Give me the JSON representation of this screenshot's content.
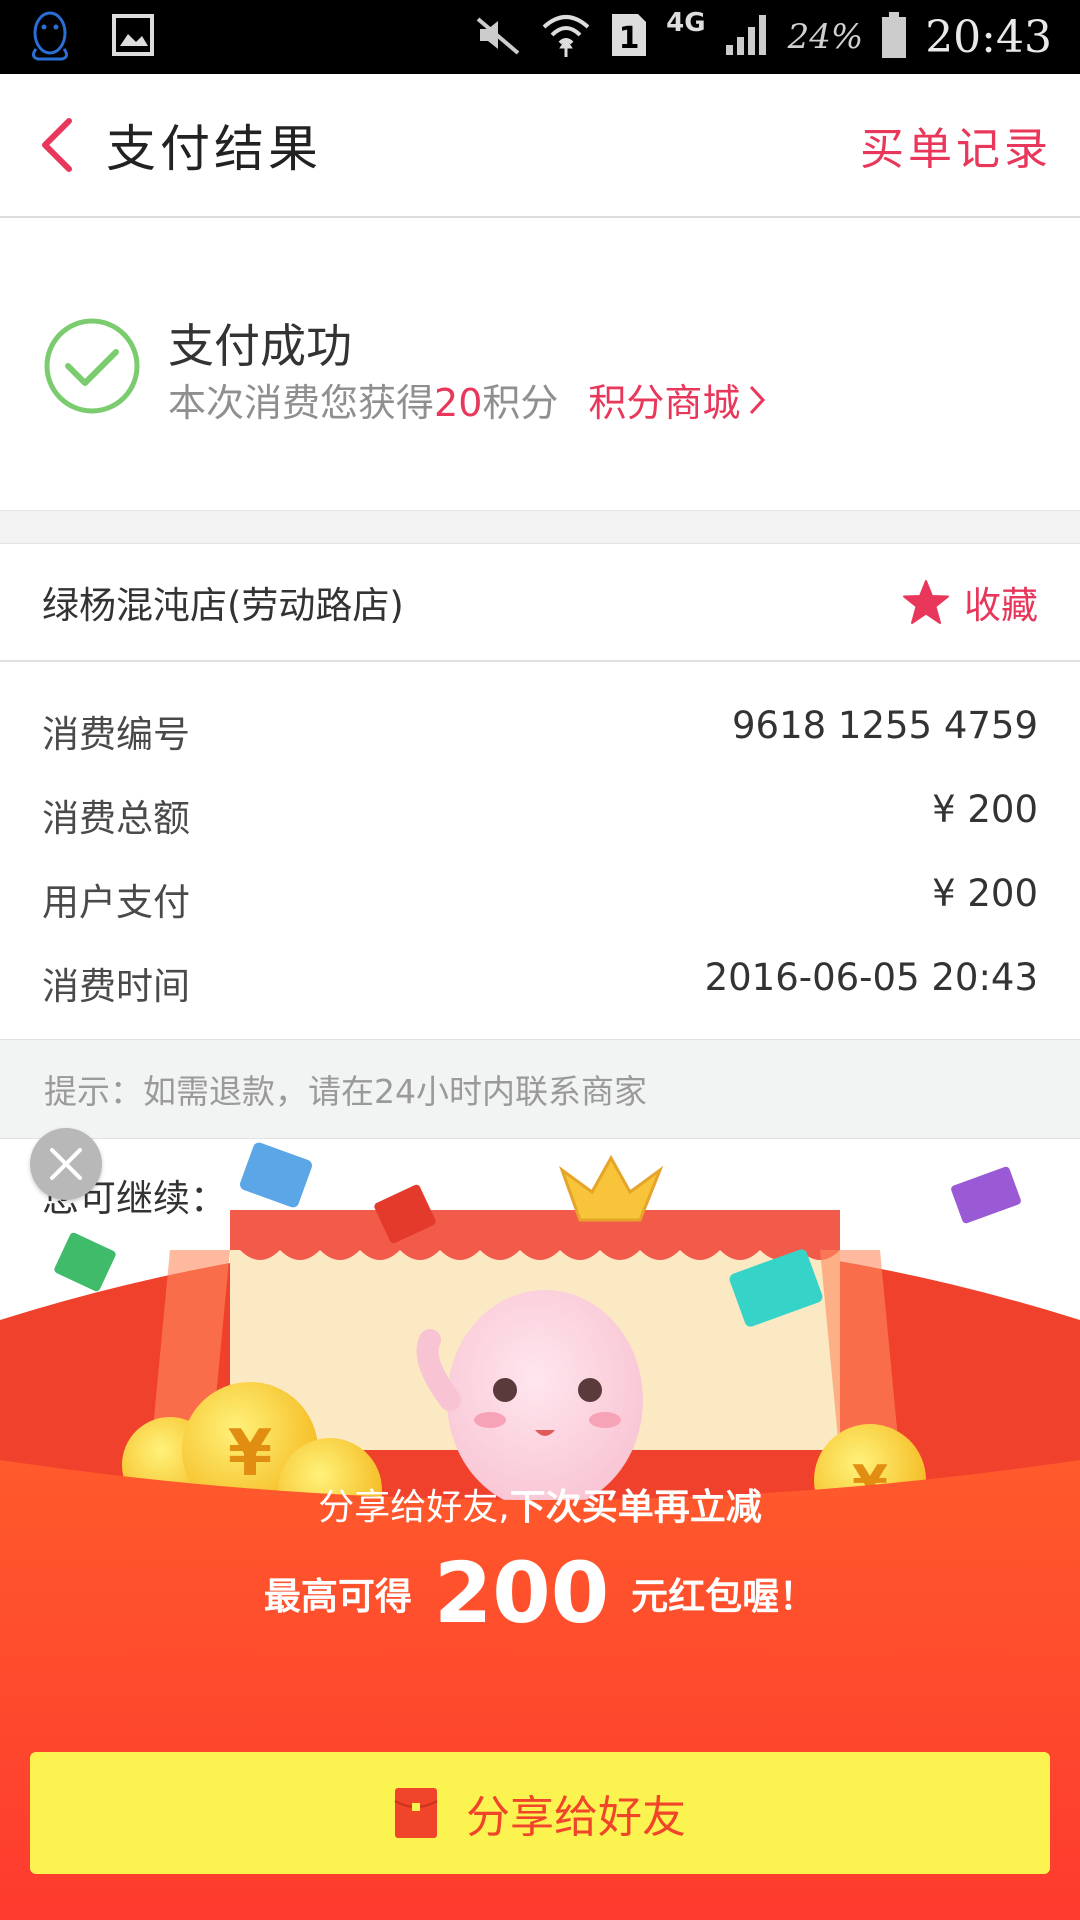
{
  "status_bar": {
    "battery": "24%",
    "network": "4G",
    "sim": "1",
    "time": "20:43"
  },
  "header": {
    "title": "支付结果",
    "records_link": "买单记录"
  },
  "success": {
    "title": "支付成功",
    "subtitle_prefix": "本次消费您获得",
    "points": "20",
    "subtitle_suffix": "积分",
    "mall_link": "积分商城"
  },
  "store": {
    "name": "绿杨混沌店(劳动路店)",
    "favorite_label": "收藏"
  },
  "details": [
    {
      "label": "消费编号",
      "value": "9618 1255 4759"
    },
    {
      "label": "消费总额",
      "value": "¥ 200"
    },
    {
      "label": "用户支付",
      "value": "¥ 200"
    },
    {
      "label": "消费时间",
      "value": "2016-06-05 20:43"
    }
  ],
  "tip": "提示：如需退款，请在24小时内联系商家",
  "continue_label": "您可继续：",
  "promo": {
    "line1_normal": "分享给好友,",
    "line1_bold": "下次买单再立减",
    "line2_prefix": "最高可得",
    "amount": "200",
    "line2_suffix": "元红包喔！",
    "share_button": "分享给好友"
  },
  "colors": {
    "accent": "#e8375a",
    "success_green": "#7acc6e",
    "promo_red": "#fe4a2d",
    "button_yellow": "#fbf450"
  }
}
